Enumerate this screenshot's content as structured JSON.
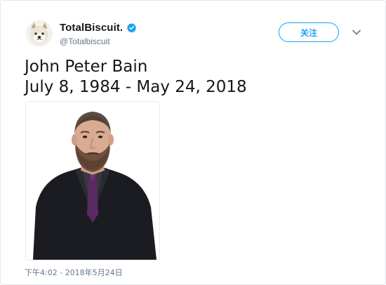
{
  "tweet": {
    "display_name": "TotalBiscuit.",
    "handle": "@Totalbiscuit",
    "verified": true,
    "follow_label": "关注",
    "text_line1": "John Peter Bain",
    "text_line2": "July 8, 1984 - May 24, 2018",
    "timestamp": "下午4:02 - 2018年5月24日"
  },
  "colors": {
    "accent": "#1da1f2",
    "text_primary": "#14171a",
    "text_secondary": "#657786"
  },
  "icons": {
    "verified": "verified-badge-icon",
    "more": "chevron-down-icon",
    "avatar": "dog-avatar"
  }
}
